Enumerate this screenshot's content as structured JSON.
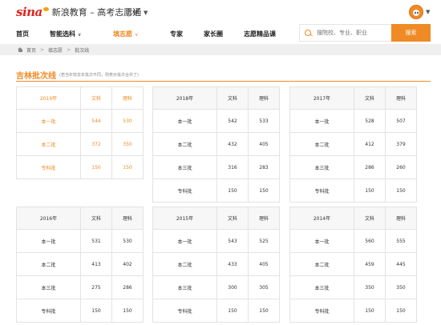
{
  "header": {
    "logo_text": "sina",
    "site_name": "新浪教育 – 高考志愿通",
    "city": "吉林",
    "brand_color": "#f08a24"
  },
  "nav": {
    "items": [
      {
        "label": "首页",
        "has_dropdown": false
      },
      {
        "label": "智能选科",
        "has_dropdown": true
      },
      {
        "label": "填志愿",
        "has_dropdown": true,
        "active": true
      },
      {
        "label": "专家",
        "has_dropdown": false
      },
      {
        "label": "家长圈",
        "has_dropdown": false
      },
      {
        "label": "志愿精品课",
        "has_dropdown": false
      }
    ],
    "search_placeholder": "搜院校、专业、职业",
    "search_button": "搜索"
  },
  "breadcrumb": [
    "首页",
    "填志愿",
    "批次线"
  ],
  "section": {
    "title": "吉林批次线",
    "note": "(若当年较去年批次不同，则表示批次合并了)"
  },
  "tables": [
    {
      "year": "2019年",
      "col_wenke": "文科",
      "col_like": "理科",
      "highlight": true,
      "rows": [
        {
          "batch": "本一批",
          "wenke": "544",
          "like": "530"
        },
        {
          "batch": "本二批",
          "wenke": "372",
          "like": "350"
        },
        {
          "batch": "专科批",
          "wenke": "150",
          "like": "150"
        }
      ]
    },
    {
      "year": "2018年",
      "col_wenke": "文科",
      "col_like": "理科",
      "highlight": false,
      "rows": [
        {
          "batch": "本一批",
          "wenke": "542",
          "like": "533"
        },
        {
          "batch": "本二批",
          "wenke": "432",
          "like": "405"
        },
        {
          "batch": "本三批",
          "wenke": "316",
          "like": "283"
        },
        {
          "batch": "专科批",
          "wenke": "150",
          "like": "150"
        }
      ]
    },
    {
      "year": "2017年",
      "col_wenke": "文科",
      "col_like": "理科",
      "highlight": false,
      "rows": [
        {
          "batch": "本一批",
          "wenke": "528",
          "like": "507"
        },
        {
          "batch": "本二批",
          "wenke": "412",
          "like": "379"
        },
        {
          "batch": "本三批",
          "wenke": "286",
          "like": "260"
        },
        {
          "batch": "专科批",
          "wenke": "150",
          "like": "150"
        }
      ]
    },
    {
      "year": "2016年",
      "col_wenke": "文科",
      "col_like": "理科",
      "highlight": false,
      "rows": [
        {
          "batch": "本一批",
          "wenke": "531",
          "like": "530"
        },
        {
          "batch": "本二批",
          "wenke": "413",
          "like": "402"
        },
        {
          "batch": "本三批",
          "wenke": "275",
          "like": "286"
        },
        {
          "batch": "专科批",
          "wenke": "150",
          "like": "150"
        }
      ]
    },
    {
      "year": "2015年",
      "col_wenke": "文科",
      "col_like": "理科",
      "highlight": false,
      "rows": [
        {
          "batch": "本一批",
          "wenke": "543",
          "like": "525"
        },
        {
          "batch": "本二批",
          "wenke": "433",
          "like": "405"
        },
        {
          "batch": "本三批",
          "wenke": "300",
          "like": "305"
        },
        {
          "batch": "专科批",
          "wenke": "150",
          "like": "150"
        }
      ]
    },
    {
      "year": "2014年",
      "col_wenke": "文科",
      "col_like": "理科",
      "highlight": false,
      "rows": [
        {
          "batch": "本一批",
          "wenke": "560",
          "like": "555"
        },
        {
          "batch": "本二批",
          "wenke": "459",
          "like": "445"
        },
        {
          "batch": "本三批",
          "wenke": "350",
          "like": "350"
        },
        {
          "batch": "专科批",
          "wenke": "150",
          "like": "150"
        }
      ]
    }
  ]
}
